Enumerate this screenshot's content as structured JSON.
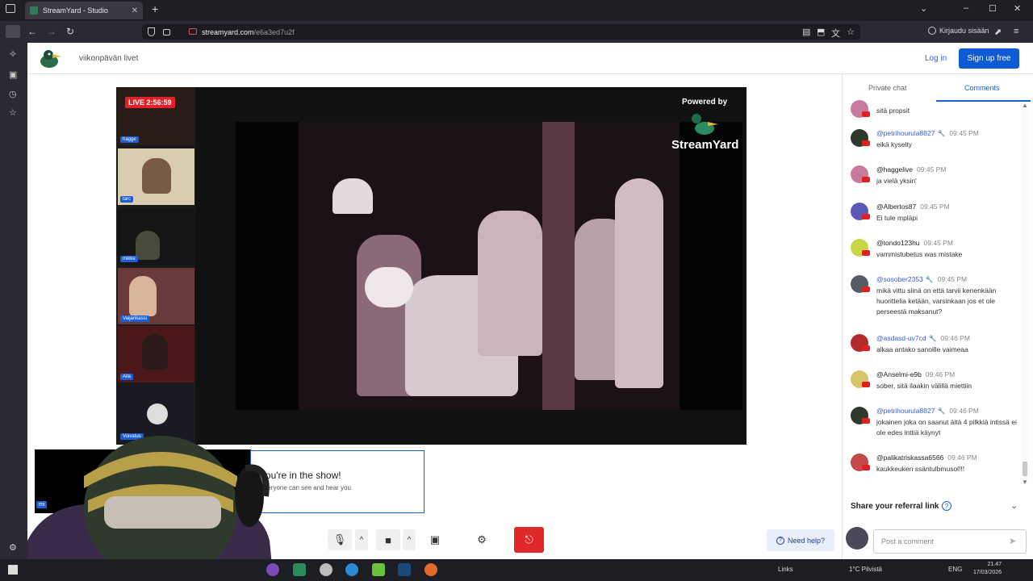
{
  "browser": {
    "tab_title": "StreamYard - Studio",
    "url_host": "streamyard.com",
    "url_path": "/e6a3ed7u2f",
    "signin_label": "Kirjaudu sisään"
  },
  "header": {
    "broadcast_title": "viikonpävän livet",
    "login_label": "Log in",
    "signup_label": "Sign up free"
  },
  "stage": {
    "live_badge": "LIVE 2:56:59",
    "powered_by": "Powered by",
    "brand": "StreamYard",
    "participants": [
      {
        "name": "hagge"
      },
      {
        "name": "tarc"
      },
      {
        "name": "mikke"
      },
      {
        "name": "Vaijarikassi"
      },
      {
        "name": "Aila"
      },
      {
        "name": "Voivatus"
      }
    ]
  },
  "self": {
    "name_tag": "mi",
    "show_title": "You're in the show!",
    "show_sub": "Everyone can see and hear you"
  },
  "controls": {
    "help_label": "Need help?"
  },
  "chat": {
    "tab_private": "Private chat",
    "tab_comments": "Comments",
    "comments": [
      {
        "user": "",
        "time": "",
        "mod": false,
        "message": "sitä propsit",
        "avatar_color": "#c77a9c"
      },
      {
        "user": "@petrihourula8827",
        "time": "09:45 PM",
        "mod": true,
        "message": "eikä kyselty",
        "avatar_color": "#2d3b2f"
      },
      {
        "user": "@haggelive",
        "time": "09:45 PM",
        "mod": false,
        "message": "ja vielä yksin'",
        "avatar_color": "#c77a9c"
      },
      {
        "user": "@Albertos87",
        "time": "09:45 PM",
        "mod": false,
        "message": "Ei tule mpläpi",
        "avatar_color": "#5b59b8"
      },
      {
        "user": "@tondo123hu",
        "time": "09:45 PM",
        "mod": false,
        "message": "vammistubetus was mistake",
        "avatar_color": "#c9d644"
      },
      {
        "user": "@sosober2353",
        "time": "09:45 PM",
        "mod": true,
        "message": "mikä vittu siinä on että tarvii kenenkään huorittelia ketään, varsinkaan jos et ole perseestä maksanut?",
        "avatar_color": "#555c66"
      },
      {
        "user": "@asdasd-uv7cd",
        "time": "09:46 PM",
        "mod": true,
        "message": "alkaa antako sanoille vaimeaa",
        "avatar_color": "#b22a2a"
      },
      {
        "user": "@Anselmi-e9b",
        "time": "09:46 PM",
        "mod": false,
        "message": "sober, sitä ilaakin välillä miettiin",
        "avatar_color": "#d9c36a"
      },
      {
        "user": "@petrihourula8827",
        "time": "09:46 PM",
        "mod": true,
        "message": "jokainen joka on saanut äitä 4 pilkkiä intissä ei ole edes inttiä käynyt",
        "avatar_color": "#2d3b2f"
      },
      {
        "user": "@palikatriskassa6566",
        "time": "09:46 PM",
        "mod": false,
        "message": "kaukkeuken ssäntulbmusol!!!",
        "avatar_color": "#c44a4a"
      }
    ],
    "referral_label": "Share your referral link",
    "input_placeholder": "Post a comment"
  },
  "taskbar": {
    "links_label": "Links",
    "weather": "1°C Pilvistä",
    "lang": "ENG",
    "time": "21.47",
    "date": "17/03/2026"
  }
}
